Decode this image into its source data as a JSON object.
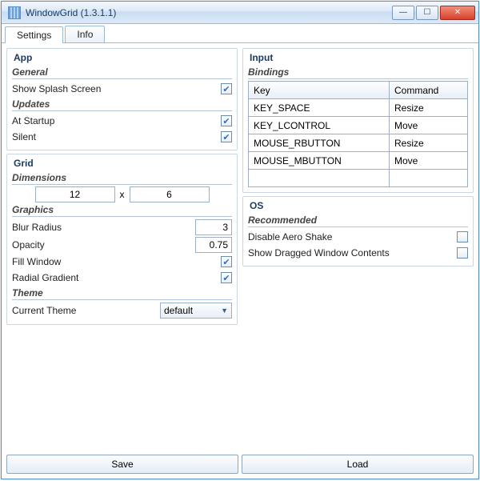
{
  "window": {
    "title": "WindowGrid (1.3.1.1)"
  },
  "tabs": {
    "settings": "Settings",
    "info": "Info"
  },
  "app": {
    "title": "App",
    "general": {
      "heading": "General",
      "splash_label": "Show Splash Screen",
      "splash_checked": true
    },
    "updates": {
      "heading": "Updates",
      "startup_label": "At Startup",
      "startup_checked": true,
      "silent_label": "Silent",
      "silent_checked": true
    }
  },
  "grid": {
    "title": "Grid",
    "dimensions": {
      "heading": "Dimensions",
      "cols": "12",
      "sep": "x",
      "rows": "6"
    },
    "graphics": {
      "heading": "Graphics",
      "blur_label": "Blur Radius",
      "blur_value": "3",
      "opacity_label": "Opacity",
      "opacity_value": "0.75",
      "fill_label": "Fill Window",
      "fill_checked": true,
      "radial_label": "Radial Gradient",
      "radial_checked": true
    },
    "theme": {
      "heading": "Theme",
      "current_label": "Current Theme",
      "current_value": "default"
    }
  },
  "input": {
    "title": "Input",
    "bindings_heading": "Bindings",
    "key_header": "Key",
    "command_header": "Command",
    "rows": [
      {
        "key": "KEY_SPACE",
        "cmd": "Resize"
      },
      {
        "key": "KEY_LCONTROL",
        "cmd": "Move"
      },
      {
        "key": "MOUSE_RBUTTON",
        "cmd": "Resize"
      },
      {
        "key": "MOUSE_MBUTTON",
        "cmd": "Move"
      },
      {
        "key": "",
        "cmd": ""
      }
    ]
  },
  "os": {
    "title": "OS",
    "recommended": "Recommended",
    "aero_label": "Disable Aero Shake",
    "aero_checked": false,
    "drag_label": "Show Dragged Window Contents",
    "drag_checked": false
  },
  "buttons": {
    "save": "Save",
    "load": "Load"
  }
}
